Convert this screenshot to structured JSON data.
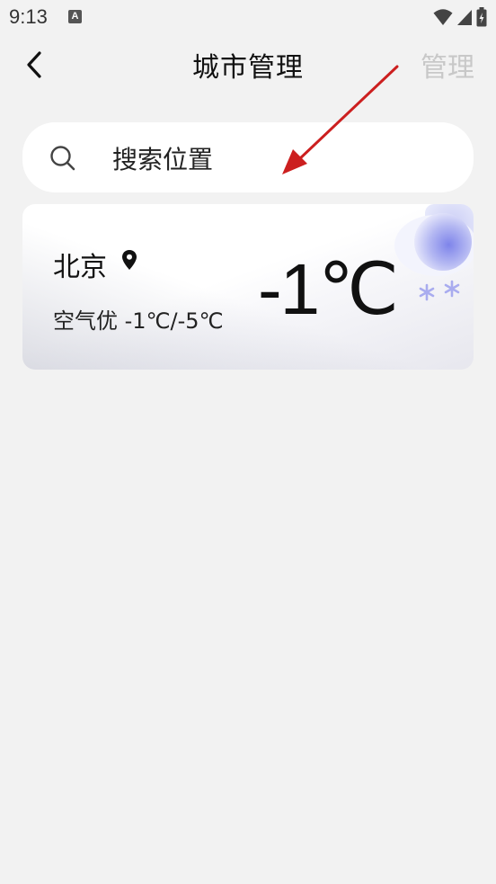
{
  "status_bar": {
    "time": "9:13",
    "notification_letter": "A",
    "icons": [
      "wifi-icon",
      "cellular-signal-icon",
      "battery-charging-icon"
    ]
  },
  "header": {
    "back_icon": "chevron-left-icon",
    "title": "城市管理",
    "manage_label": "管理"
  },
  "search": {
    "icon": "search-icon",
    "placeholder": "搜索位置"
  },
  "cities": [
    {
      "name": "北京",
      "is_current_location": true,
      "air_quality": "空气优 -1℃/-5℃",
      "temperature": "-1℃",
      "weather_icon": "snow-cloud-icon"
    }
  ],
  "colors": {
    "background": "#f2f2f2",
    "card": "#ffffff",
    "manage_disabled": "#c8c8c8",
    "annotation_arrow": "#cc1f1f",
    "weather_icon_accent": "#8a8fe8"
  }
}
